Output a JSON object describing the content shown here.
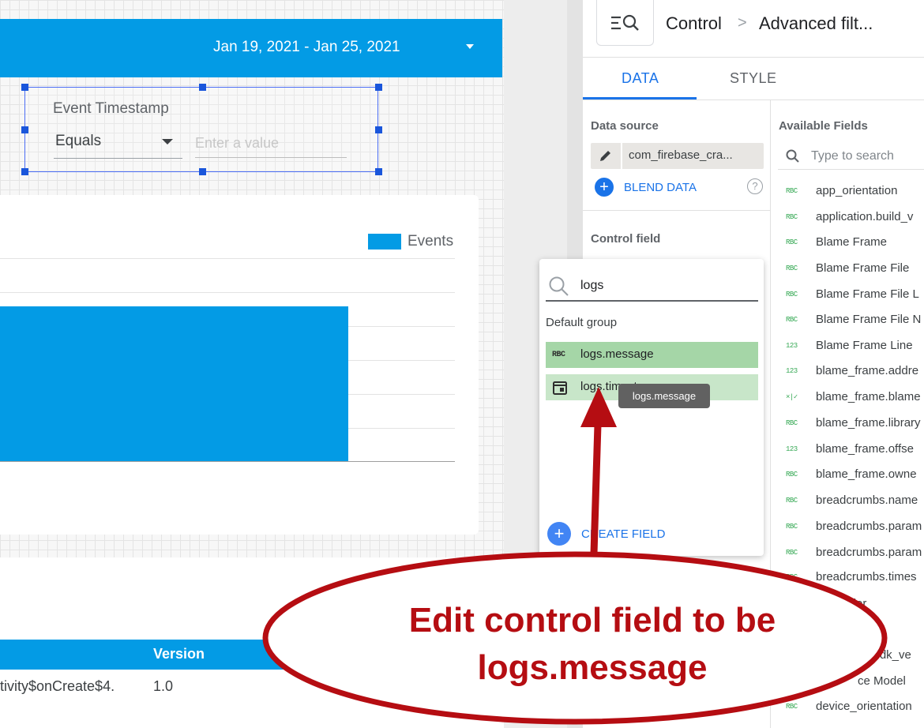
{
  "report": {
    "date_range": "Jan 19, 2021 - Jan 25, 2021",
    "filter_control": {
      "label": "Event Timestamp",
      "operator": "Equals",
      "value_placeholder": "Enter a value"
    },
    "chart": {
      "legend": "Events"
    },
    "table": {
      "columns": [
        "Version"
      ],
      "rows": [
        {
          "activity": "tivity$onCreate$4.",
          "version": "1.0"
        }
      ]
    }
  },
  "chart_data": {
    "type": "bar",
    "series": [
      {
        "name": "Events"
      }
    ],
    "legend": "top-right"
  },
  "panel": {
    "breadcrumb": {
      "component": "Control",
      "separator": ">",
      "type": "Advanced filt..."
    },
    "tabs": [
      {
        "label": "DATA",
        "active": true
      },
      {
        "label": "STYLE",
        "active": false
      }
    ],
    "data_source": {
      "heading": "Data source",
      "name": "com_firebase_cra...",
      "blend_label": "BLEND DATA",
      "help": "?"
    },
    "control_field": {
      "heading": "Control field"
    },
    "available_fields": {
      "heading": "Available Fields",
      "search_placeholder": "Type to search",
      "items": [
        {
          "type": "RBC",
          "name": "app_orientation"
        },
        {
          "type": "RBC",
          "name": "application.build_v"
        },
        {
          "type": "RBC",
          "name": "Blame Frame"
        },
        {
          "type": "RBC",
          "name": "Blame Frame File"
        },
        {
          "type": "RBC",
          "name": "Blame Frame File L"
        },
        {
          "type": "RBC",
          "name": "Blame Frame File N"
        },
        {
          "type": "123",
          "name": "Blame Frame Line"
        },
        {
          "type": "123",
          "name": "blame_frame.addre"
        },
        {
          "type": "×|✓",
          "name": "blame_frame.blame"
        },
        {
          "type": "RBC",
          "name": "blame_frame.library"
        },
        {
          "type": "123",
          "name": "blame_frame.offse"
        },
        {
          "type": "RBC",
          "name": "blame_frame.owne"
        },
        {
          "type": "RBC",
          "name": "breadcrumbs.name"
        },
        {
          "type": "RBC",
          "name": "breadcrumbs.param"
        },
        {
          "type": "RBC",
          "name": "breadcrumbs.param"
        },
        {
          "type": "RBC",
          "name": "breadcrumbs.times"
        },
        {
          "type": "",
          "name": "dentifier"
        },
        {
          "type": "",
          "name": ""
        },
        {
          "type": "",
          "name": "_sdk_ve"
        },
        {
          "type": "",
          "name": "ce Model"
        },
        {
          "type": "RBC",
          "name": "device_orientation"
        }
      ]
    }
  },
  "dropdown": {
    "search_value": "logs",
    "group_label": "Default group",
    "items": [
      {
        "type": "RBC",
        "label": "logs.message"
      },
      {
        "type": "date",
        "label": "logs.timestamp"
      }
    ],
    "tooltip": "logs.message",
    "create_label": "CREATE FIELD"
  },
  "annotation": {
    "text_line1": "Edit control field to be",
    "text_line2": "logs.message",
    "color": "#b50d12"
  },
  "colors": {
    "accent": "#039be5",
    "link": "#1a73e8",
    "field_highlight": "#a5d6a7"
  }
}
